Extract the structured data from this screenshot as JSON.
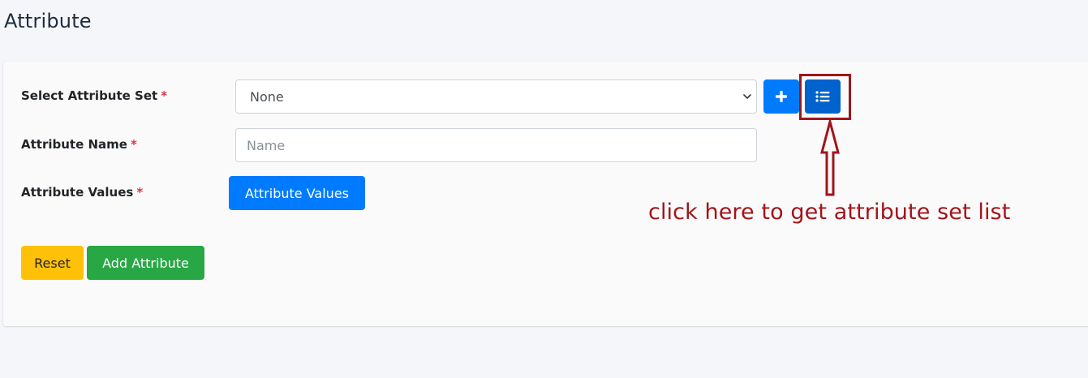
{
  "page": {
    "title": "Attribute"
  },
  "form": {
    "attribute_set": {
      "label": "Select Attribute Set",
      "required_mark": "*",
      "selected": "None"
    },
    "attribute_name": {
      "label": "Attribute Name",
      "required_mark": "*",
      "placeholder": "Name",
      "value": ""
    },
    "attribute_values": {
      "label": "Attribute Values",
      "required_mark": "*",
      "button_label": "Attribute Values"
    },
    "buttons": {
      "add_set_icon": "plus-icon",
      "list_sets_icon": "list-icon",
      "reset_label": "Reset",
      "add_label": "Add Attribute"
    }
  },
  "annotation": {
    "text": "click here to get attribute set list",
    "color": "#a0151b"
  },
  "colors": {
    "primary": "#007bff",
    "primary_active": "#0062cc",
    "warning": "#ffc107",
    "success": "#28a745",
    "required": "#dc3545"
  }
}
